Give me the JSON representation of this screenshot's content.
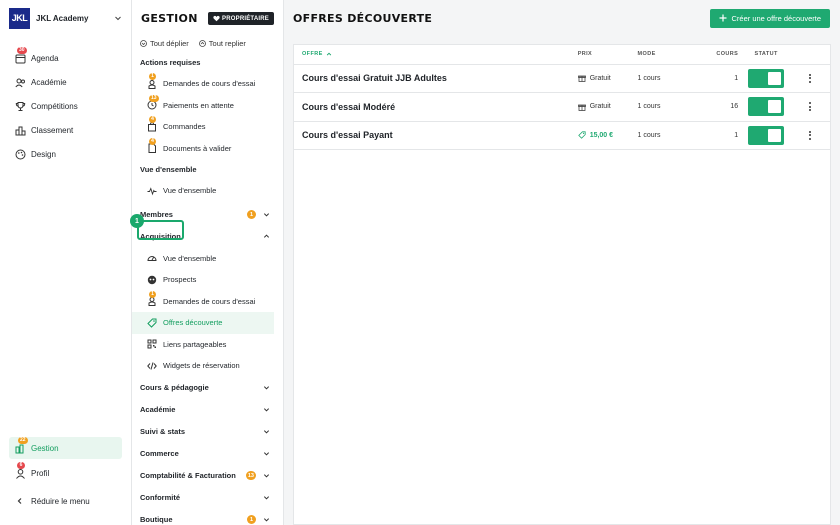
{
  "org": {
    "logo": "JKL",
    "name": "JKL Academy"
  },
  "leftnav": {
    "items": [
      {
        "label": "Agenda",
        "badge": "30",
        "icon": "calendar-icon"
      },
      {
        "label": "Académie",
        "icon": "users-icon"
      },
      {
        "label": "Compétitions",
        "icon": "trophy-icon"
      },
      {
        "label": "Classement",
        "icon": "podium-icon"
      },
      {
        "label": "Design",
        "icon": "palette-icon"
      }
    ],
    "bottom": [
      {
        "label": "Gestion",
        "badge": "22",
        "icon": "gestion-icon"
      },
      {
        "label": "Profil",
        "badge": "6",
        "icon": "user-icon"
      },
      {
        "label": "Réduire le menu",
        "icon": "chevron-left-icon"
      }
    ]
  },
  "mid": {
    "title": "GESTION",
    "owner": "PROPRIÉTAIRE",
    "expand_all": "Tout déplier",
    "collapse_all": "Tout replier",
    "actions_title": "Actions requises",
    "actions": [
      {
        "label": "Demandes de cours d'essai",
        "badge": "1"
      },
      {
        "label": "Paiements en attente",
        "badge": "13"
      },
      {
        "label": "Commandes",
        "badge": "4"
      },
      {
        "label": "Documents à valider",
        "badge": "4"
      }
    ],
    "overview_title": "Vue d'ensemble",
    "overview_item": "Vue d'ensemble",
    "members": {
      "label": "Membres",
      "badge": "1"
    },
    "acquisition": {
      "label": "Acquisition",
      "step": "1"
    },
    "acq_items": [
      {
        "label": "Vue d'ensemble"
      },
      {
        "label": "Prospects"
      },
      {
        "label": "Demandes de cours d'essai",
        "badge": "1"
      },
      {
        "label": "Offres découverte"
      },
      {
        "label": "Liens partageables"
      },
      {
        "label": "Widgets de réservation"
      }
    ],
    "sections": [
      {
        "label": "Cours & pédagogie"
      },
      {
        "label": "Académie"
      },
      {
        "label": "Suivi & stats"
      },
      {
        "label": "Commerce"
      },
      {
        "label": "Comptabilité & Facturation",
        "badge": "13"
      },
      {
        "label": "Conformité"
      },
      {
        "label": "Boutique",
        "badge": "1"
      }
    ]
  },
  "main": {
    "title": "OFFRES DÉCOUVERTE",
    "create": "Créer une offre découverte",
    "columns": {
      "offer": "OFFRE",
      "price": "PRIX",
      "mode": "MODE",
      "courses": "COURS",
      "status": "STATUT"
    },
    "rows": [
      {
        "name": "Cours d'essai Gratuit JJB Adultes",
        "price": "Gratuit",
        "price_type": "free",
        "mode": "1 cours",
        "courses": "1",
        "active": true
      },
      {
        "name": "Cours d'essai Modéré",
        "price": "Gratuit",
        "price_type": "free",
        "mode": "1 cours",
        "courses": "16",
        "active": true
      },
      {
        "name": "Cours d'essai Payant",
        "price": "15,00 €",
        "price_type": "paid",
        "mode": "1 cours",
        "courses": "1",
        "active": true
      }
    ]
  },
  "colors": {
    "accent": "#1fa971",
    "badge_red": "#e5484d",
    "badge_orange": "#f0a020"
  }
}
